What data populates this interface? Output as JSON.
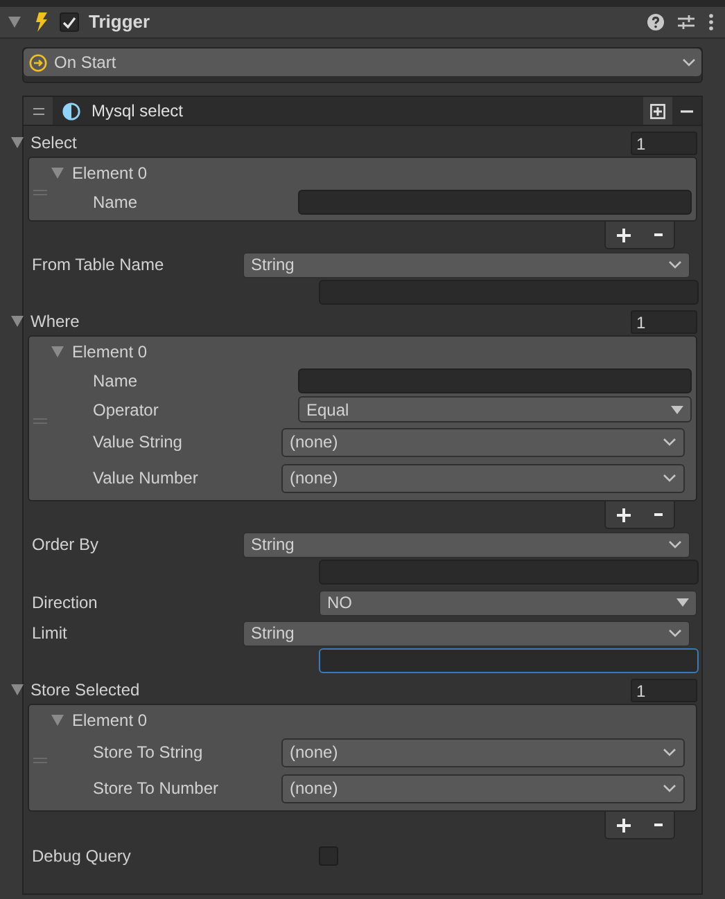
{
  "component": {
    "title": "Trigger",
    "enabled": true,
    "expanded": true
  },
  "event": {
    "value": "On Start"
  },
  "action": {
    "title": "Mysql select"
  },
  "fields": [
    {
      "kind": "list",
      "label": "Select",
      "expanded": true,
      "count": "1",
      "elements": [
        {
          "title": "Element 0",
          "expanded": true,
          "fields": [
            {
              "kind": "text",
              "label": "Name"
            }
          ]
        }
      ]
    },
    {
      "kind": "typed",
      "label": "From Table Name",
      "type": "String",
      "focused": false
    },
    {
      "kind": "list",
      "label": "Where",
      "expanded": true,
      "count": "1",
      "elements": [
        {
          "title": "Element 0",
          "expanded": true,
          "fields": [
            {
              "kind": "text",
              "label": "Name"
            },
            {
              "kind": "enum",
              "label": "Operator",
              "value": "Equal"
            },
            {
              "kind": "object",
              "label": "Value String",
              "value": "(none)"
            },
            {
              "kind": "object",
              "label": "Value Number",
              "value": "(none)"
            }
          ]
        }
      ]
    },
    {
      "kind": "typed",
      "label": "Order By",
      "type": "String",
      "focused": false
    },
    {
      "kind": "enum",
      "label": "Direction",
      "value": "NO"
    },
    {
      "kind": "typed",
      "label": "Limit",
      "type": "String",
      "focused": true
    },
    {
      "kind": "list",
      "label": "Store Selected",
      "expanded": true,
      "count": "1",
      "elements": [
        {
          "title": "Element 0",
          "expanded": true,
          "fields": [
            {
              "kind": "object",
              "label": "Store To String",
              "value": "(none)"
            },
            {
              "kind": "object",
              "label": "Store To Number",
              "value": "(none)"
            }
          ]
        }
      ]
    },
    {
      "kind": "toggle",
      "label": "Debug Query",
      "checked": false
    }
  ]
}
